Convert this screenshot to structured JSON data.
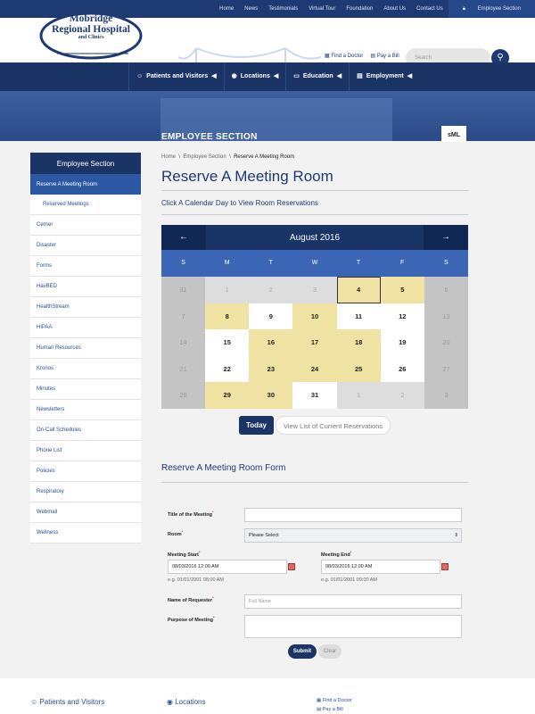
{
  "top_nav": [
    "Home",
    "News",
    "Testimonials",
    "Virtual Tour",
    "Foundation",
    "About Us",
    "Contact Us"
  ],
  "top_nav_employee": "Employee Section",
  "logo": {
    "line1": "Mobridge",
    "line2": "Regional Hospital",
    "line3": "and Clinics"
  },
  "header_links": {
    "find_doctor": "Find a Doctor",
    "pay_bill": "Pay a Bill"
  },
  "search": {
    "placeholder": "Search"
  },
  "main_nav": [
    "Patients and Visitors",
    "Locations",
    "Education",
    "Employment"
  ],
  "hero_title": "EMPLOYEE SECTION",
  "font_size_label": "sML",
  "sidebar": {
    "heading": "Employee Section",
    "active": "Reserve A Meeting Room",
    "items": [
      "Reserved Meetings",
      "Cerner",
      "Disaster",
      "Forms",
      "HavBED",
      "HealthStream",
      "HIPAA",
      "Human Resources",
      "Kronos",
      "Minutes",
      "Newsletters",
      "On-Call Schedules",
      "Phone List",
      "Policies",
      "Respiratory",
      "Webmail",
      "Wellness"
    ]
  },
  "breadcrumb": [
    "Home",
    "Employee Section",
    "Reserve A Meeting Room"
  ],
  "page_title": "Reserve A Meeting Room",
  "subtitle": "Click A Calendar Day to View Room Reservations",
  "calendar": {
    "month": "August 2016",
    "prev": "←",
    "next": "→",
    "days_of_week": [
      "S",
      "M",
      "T",
      "W",
      "T",
      "F",
      "S"
    ],
    "weeks": [
      [
        {
          "d": "31",
          "t": "we"
        },
        {
          "d": "1",
          "t": "off"
        },
        {
          "d": "2",
          "t": "off"
        },
        {
          "d": "3",
          "t": "off"
        },
        {
          "d": "4",
          "t": "res sel"
        },
        {
          "d": "5",
          "t": "res"
        },
        {
          "d": "6",
          "t": "we"
        }
      ],
      [
        {
          "d": "7",
          "t": "we"
        },
        {
          "d": "8",
          "t": "res"
        },
        {
          "d": "9",
          "t": "wh"
        },
        {
          "d": "10",
          "t": "res"
        },
        {
          "d": "11",
          "t": "wh"
        },
        {
          "d": "12",
          "t": "wh"
        },
        {
          "d": "13",
          "t": "we"
        }
      ],
      [
        {
          "d": "14",
          "t": "we"
        },
        {
          "d": "15",
          "t": "wh"
        },
        {
          "d": "16",
          "t": "res"
        },
        {
          "d": "17",
          "t": "res"
        },
        {
          "d": "18",
          "t": "res"
        },
        {
          "d": "19",
          "t": "wh"
        },
        {
          "d": "20",
          "t": "we"
        }
      ],
      [
        {
          "d": "21",
          "t": "we"
        },
        {
          "d": "22",
          "t": "wh"
        },
        {
          "d": "23",
          "t": "res"
        },
        {
          "d": "24",
          "t": "res"
        },
        {
          "d": "25",
          "t": "res"
        },
        {
          "d": "26",
          "t": "wh"
        },
        {
          "d": "27",
          "t": "we"
        }
      ],
      [
        {
          "d": "28",
          "t": "we"
        },
        {
          "d": "29",
          "t": "res"
        },
        {
          "d": "30",
          "t": "res"
        },
        {
          "d": "31",
          "t": "wh"
        },
        {
          "d": "1",
          "t": "off"
        },
        {
          "d": "2",
          "t": "off"
        },
        {
          "d": "3",
          "t": "we"
        }
      ]
    ]
  },
  "buttons": {
    "today": "Today",
    "list": "View List of Current Reservations"
  },
  "form_title": "Reserve A Meeting Room Form",
  "form": {
    "title_label": "Title of the Meeting",
    "room_label": "Room",
    "room_value": "Please Select",
    "start_label": "Meeting Start",
    "start_value": "08/03/2016 12:00 AM",
    "start_hint": "e.g. 01/01/2001 08:00 AM",
    "end_label": "Meeting End",
    "end_value": "08/03/2016 12:00 AM",
    "end_hint": "e.g. 01/01/2001 09:00 AM",
    "requester_label": "Name of Requester",
    "requester_placeholder": "Full Name",
    "purpose_label": "Purpose of Meeting",
    "required": "*",
    "submit": "Submit",
    "clear": "Clear"
  },
  "footer": {
    "col1": "Patients and Visitors",
    "col2": "Locations",
    "find_doctor": "Find a Doctor",
    "pay_bill": "Pay a Bill"
  }
}
